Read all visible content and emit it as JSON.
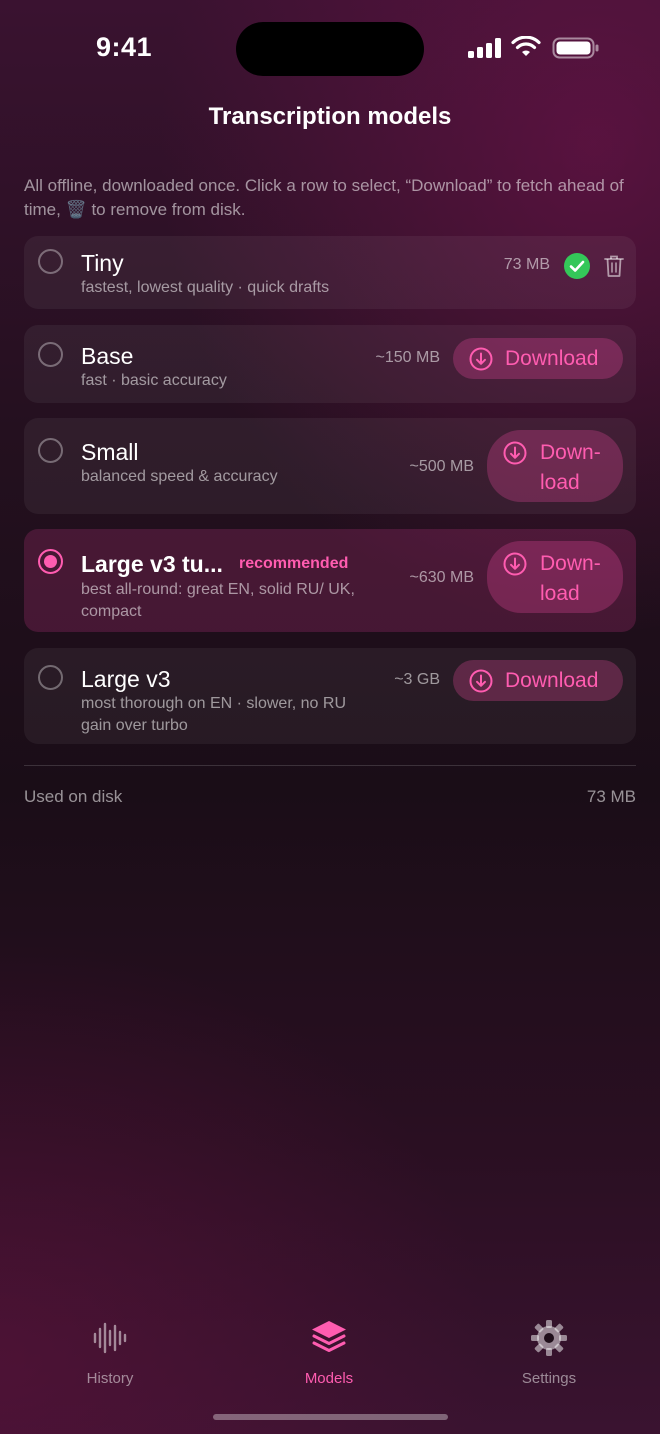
{
  "status_bar": {
    "time": "9:41"
  },
  "header": {
    "title": "Transcription models"
  },
  "intro": {
    "text": "All offline, downloaded once. Click a row to select, “Download” to fetch ahead of time, 🗑️ to remove from disk."
  },
  "models": [
    {
      "name": "Tiny",
      "desc": "fastest, lowest quality · quick drafts",
      "size": "73 MB",
      "selected": false,
      "state": "downloaded"
    },
    {
      "name": "Base",
      "desc": "fast · basic accuracy",
      "size": "~150 MB",
      "selected": false,
      "state": "not-downloaded",
      "action": "Download"
    },
    {
      "name": "Small",
      "desc": "balanced speed & accuracy",
      "size": "~500 MB",
      "selected": false,
      "state": "not-downloaded",
      "action": "Down-\nload"
    },
    {
      "name": "Large v3 tu...",
      "badge": "recommended",
      "desc": "best all-round: great EN, solid RU/ UK, compact",
      "size": "~630 MB",
      "selected": true,
      "state": "not-downloaded",
      "action": "Down-\nload"
    },
    {
      "name": "Large v3",
      "desc": "most thorough on EN · slower, no RU gain over turbo",
      "size": "~3 GB",
      "selected": false,
      "state": "not-downloaded",
      "action": "Download"
    }
  ],
  "footer": {
    "label": "Used on disk",
    "value": "73 MB"
  },
  "tabs": [
    {
      "label": "History",
      "icon": "waveform-icon",
      "active": false
    },
    {
      "label": "Models",
      "icon": "layers-icon",
      "active": true
    },
    {
      "label": "Settings",
      "icon": "gear-icon",
      "active": false
    }
  ],
  "colors": {
    "accent": "#ff5cb0",
    "success": "#34c759",
    "background": "#24101f"
  }
}
